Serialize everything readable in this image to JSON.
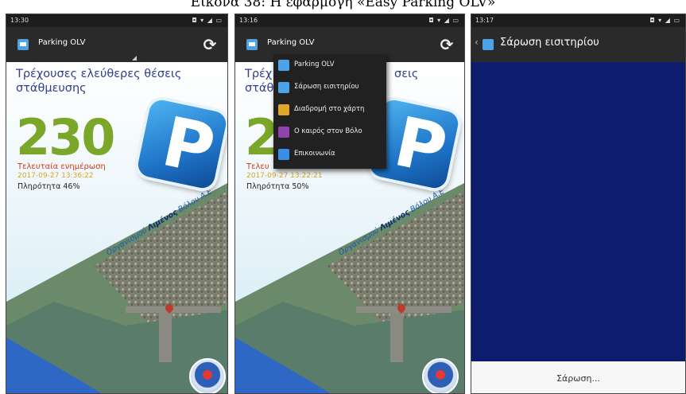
{
  "caption": "Εικόνα 38: Η εφαρμογή «Easy Parking OLV»",
  "screens": [
    {
      "status_time": "13:30",
      "status_icons": "◘ ▾ ◢ ▭",
      "toolbar_title": "Parking OLV",
      "headline": "Τρέχουσες ελεύθερες θέσεις στάθμευσης",
      "free_spaces": "230",
      "last_update_label": "Τελευταία ενημέρωση",
      "last_update_time": "2017-09-27 13:36:22",
      "fill_rate": "Πληρότητα 46%",
      "diagonal_text_1": "Οργανισμού ",
      "diagonal_text_bold": "Λιμένος",
      "diagonal_text_2": " Βόλου Α.Ε",
      "logo_letter": "P"
    },
    {
      "status_time": "13:16",
      "status_icons": "◘ ▾ ◢ ▭",
      "toolbar_title": "Parking OLV",
      "headline_partial": "Τρέχ",
      "headline_partial_2": "σεις",
      "headline_partial_3": "στάθ",
      "free_spaces_partial": "2",
      "last_update_partial": "Τελευ",
      "last_update_time": "2017-09-27 13:22:21",
      "fill_rate": "Πληρότητα 50%",
      "diagonal_text_1": "Οργανισμού ",
      "diagonal_text_bold": "Λιμένος",
      "diagonal_text_2": " Βόλου Α.Ε",
      "logo_letter": "P",
      "menu": [
        {
          "label": "Parking OLV",
          "icon": "parking-app-icon",
          "color": "#4da3e8"
        },
        {
          "label": "Σάρωση εισιτηρίου",
          "icon": "scan-ticket-icon",
          "color": "#4da3e8"
        },
        {
          "label": "Διαδρομή στο χάρτη",
          "icon": "map-route-icon",
          "color": "#e0a62b"
        },
        {
          "label": "Ο καιρός στον Βόλο",
          "icon": "weather-icon",
          "color": "#8e44ad"
        },
        {
          "label": "Επικοινωνία",
          "icon": "contact-icon",
          "color": "#3a8ee6"
        }
      ]
    },
    {
      "status_time": "13:17",
      "status_icons": "◘ ▾ ◢ ▭",
      "back_glyph": "‹",
      "toolbar_title": "Σάρωση εισιτηρίου",
      "scan_label": "Σάρωση..."
    }
  ],
  "colors": {
    "headline": "#2f3e8f",
    "big_number": "#7aa629",
    "last_update": "#d23b1b",
    "datetime": "#d9a61e",
    "scan_bg": "#0e1c6e"
  }
}
